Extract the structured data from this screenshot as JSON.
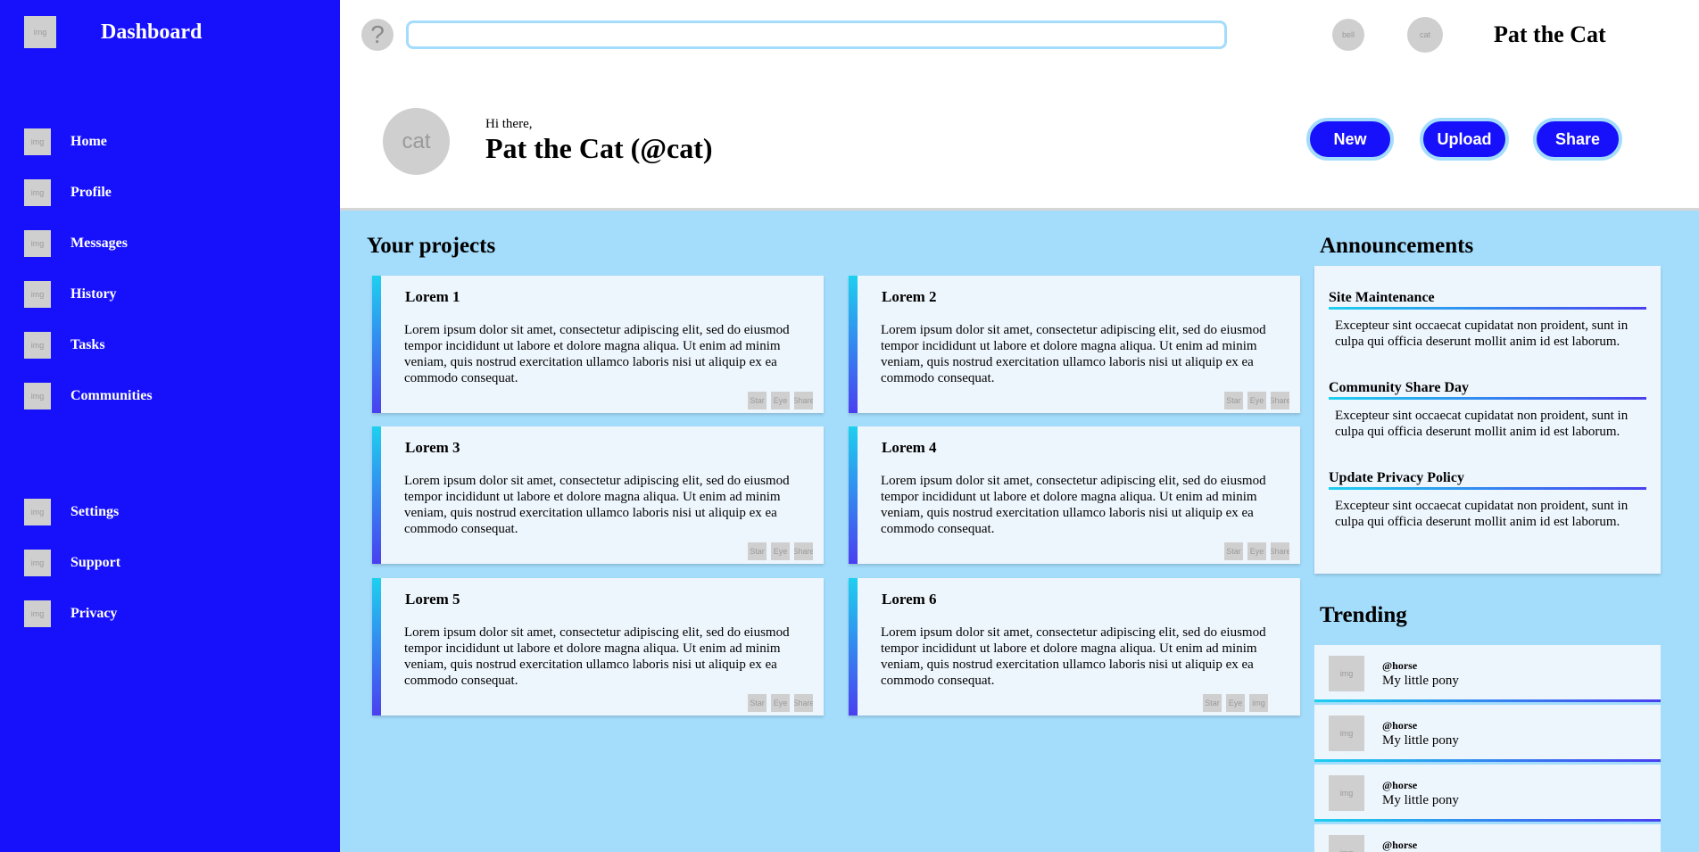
{
  "sidebar": {
    "logo_placeholder": "img",
    "title": "Dashboard",
    "items": [
      {
        "label": "Home",
        "icon": "img"
      },
      {
        "label": "Profile",
        "icon": "img"
      },
      {
        "label": "Messages",
        "icon": "img"
      },
      {
        "label": "History",
        "icon": "img"
      },
      {
        "label": "Tasks",
        "icon": "img"
      },
      {
        "label": "Communities",
        "icon": "img"
      }
    ],
    "bottom_items": [
      {
        "label": "Settings",
        "icon": "img"
      },
      {
        "label": "Support",
        "icon": "img"
      },
      {
        "label": "Privacy",
        "icon": "img"
      }
    ]
  },
  "header": {
    "help_glyph": "?",
    "search_value": "",
    "bell_placeholder": "bell",
    "avatar_placeholder": "cat",
    "user_name": "Pat the Cat",
    "large_avatar_text": "cat",
    "greeting": "Hi there,",
    "handle": "Pat the Cat (@cat)",
    "buttons": {
      "new": "New",
      "upload": "Upload",
      "share": "Share"
    }
  },
  "projects": {
    "title": "Your projects",
    "cards": [
      {
        "title": "Lorem 1",
        "body": "Lorem ipsum dolor sit amet, consectetur adipiscing elit, sed do eiusmod tempor incididunt ut labore et dolore magna aliqua. Ut enim ad minim veniam, quis nostrud exercitation ullamco laboris nisi ut aliquip ex ea commodo consequat.",
        "actions": [
          "Star",
          "Eye",
          "Share"
        ]
      },
      {
        "title": "Lorem 2",
        "body": "Lorem ipsum dolor sit amet, consectetur adipiscing elit, sed do eiusmod tempor incididunt ut labore et dolore magna aliqua. Ut enim ad minim veniam, quis nostrud exercitation ullamco laboris nisi ut aliquip ex ea commodo consequat.",
        "actions": [
          "Star",
          "Eye",
          "Share"
        ]
      },
      {
        "title": "Lorem 3",
        "body": "Lorem ipsum dolor sit amet, consectetur adipiscing elit, sed do eiusmod tempor incididunt ut labore et dolore magna aliqua. Ut enim ad minim veniam, quis nostrud exercitation ullamco laboris nisi ut aliquip ex ea commodo consequat.",
        "actions": [
          "Star",
          "Eye",
          "Share"
        ]
      },
      {
        "title": "Lorem 4",
        "body": "Lorem ipsum dolor sit amet, consectetur adipiscing elit, sed do eiusmod tempor incididunt ut labore et dolore magna aliqua. Ut enim ad minim veniam, quis nostrud exercitation ullamco laboris nisi ut aliquip ex ea commodo consequat.",
        "actions": [
          "Star",
          "Eye",
          "Share"
        ]
      },
      {
        "title": "Lorem 5",
        "body": "Lorem ipsum dolor sit amet, consectetur adipiscing elit, sed do eiusmod tempor incididunt ut labore et dolore magna aliqua. Ut enim ad minim veniam, quis nostrud exercitation ullamco laboris nisi ut aliquip ex ea commodo consequat.",
        "actions": [
          "Star",
          "Eye",
          "Share"
        ]
      },
      {
        "title": "Lorem 6",
        "body": "Lorem ipsum dolor sit amet, consectetur adipiscing elit, sed do eiusmod tempor incididunt ut labore et dolore magna aliqua. Ut enim ad minim veniam, quis nostrud exercitation ullamco laboris nisi ut aliquip ex ea commodo consequat.",
        "actions": [
          "Star",
          "Eye",
          "img"
        ]
      }
    ]
  },
  "announcements": {
    "title": "Announcements",
    "items": [
      {
        "title": "Site Maintenance",
        "body": "Excepteur sint occaecat cupidatat non proident, sunt in culpa qui officia deserunt mollit anim id est laborum."
      },
      {
        "title": "Community Share Day",
        "body": "Excepteur sint occaecat cupidatat non proident, sunt in culpa qui officia deserunt mollit anim id est laborum."
      },
      {
        "title": "Update Privacy Policy",
        "body": "Excepteur sint occaecat cupidatat non proident, sunt in culpa qui officia deserunt mollit anim id est laborum."
      }
    ]
  },
  "trending": {
    "title": "Trending",
    "items": [
      {
        "handle": "@horse",
        "text": "My little pony",
        "thumb": "img"
      },
      {
        "handle": "@horse",
        "text": "My little pony",
        "thumb": "img"
      },
      {
        "handle": "@horse",
        "text": "My little pony",
        "thumb": "img"
      },
      {
        "handle": "@horse",
        "text": "",
        "thumb": "img"
      }
    ]
  },
  "colors": {
    "sidebar": "#1711fb",
    "page_bg": "#a4dcfb",
    "card_bg": "#eef6fd",
    "accent_gradient_start": "#1ed0ef",
    "accent_gradient_end": "#4a3ff0"
  }
}
